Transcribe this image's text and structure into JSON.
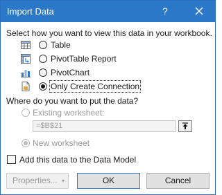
{
  "window": {
    "title": "Import Data",
    "help_label": "?"
  },
  "view_section": {
    "prompt": "Select how you want to view this data in your workbook.",
    "options": [
      {
        "label": "Table",
        "icon": "table-icon",
        "selected": false
      },
      {
        "label": "PivotTable Report",
        "icon": "pivottable-icon",
        "selected": false
      },
      {
        "label": "PivotChart",
        "icon": "pivotchart-icon",
        "selected": false
      },
      {
        "label": "Only Create Connection",
        "icon": "connection-icon",
        "selected": true
      }
    ]
  },
  "location_section": {
    "prompt": "Where do you want to put the data?",
    "existing_label": "Existing worksheet:",
    "existing_value": "=$B$21",
    "new_label": "New worksheet",
    "new_selected": true
  },
  "data_model": {
    "label": "Add this data to the Data Model",
    "checked": false
  },
  "buttons": {
    "properties": "Properties...",
    "ok": "OK",
    "cancel": "Cancel"
  },
  "colors": {
    "titlebar": "#2b78c9",
    "accent": "#2b78c9"
  }
}
